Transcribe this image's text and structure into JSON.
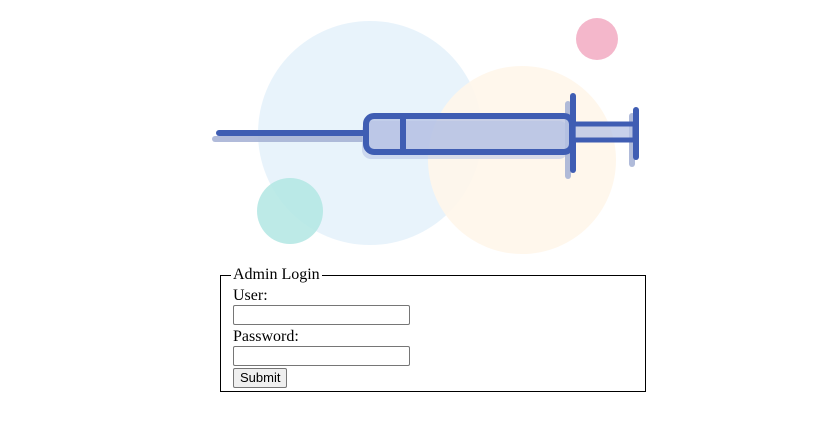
{
  "illustration": {
    "icon": "syringe-icon",
    "colors": {
      "circle_blue": "#e6f2fb",
      "circle_peach": "#fff6ea",
      "circle_teal": "#b1e6e3",
      "circle_pink": "#f4b7cb",
      "syringe_stroke": "#3f5db3",
      "syringe_barrel": "#b6c2e4",
      "syringe_shadow": "#a8b4d6"
    }
  },
  "login": {
    "legend": "Admin Login",
    "user_label": "User:",
    "user_value": "",
    "password_label": "Password:",
    "password_value": "",
    "submit_label": "Submit"
  }
}
